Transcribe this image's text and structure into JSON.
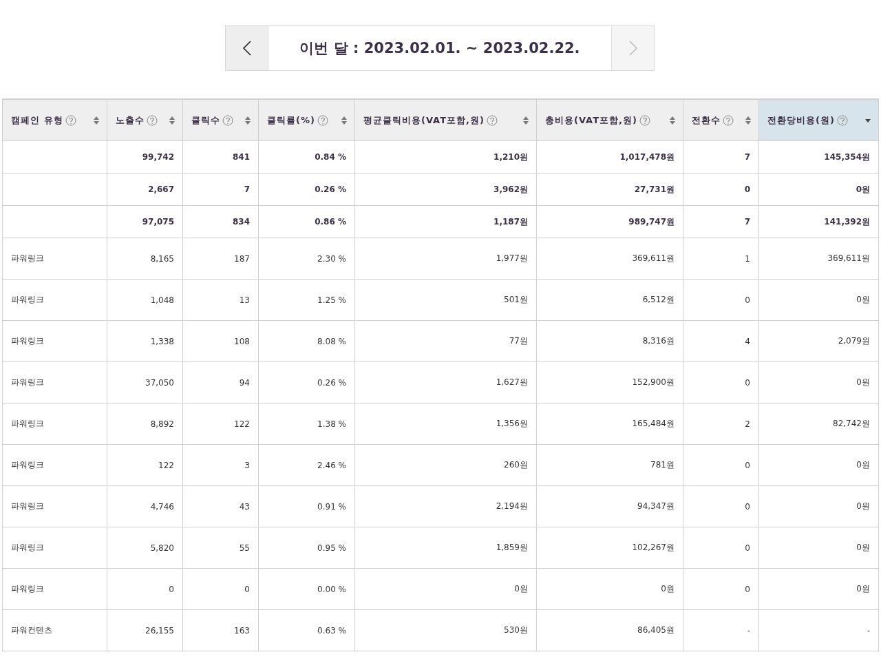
{
  "period": {
    "label": "이번 달 : 2023.02.01. ~ 2023.02.22.",
    "prev_disabled": false,
    "next_disabled": true
  },
  "table": {
    "columns": [
      {
        "label": "캠페인 유형",
        "sorted": false
      },
      {
        "label": "노출수",
        "sorted": false
      },
      {
        "label": "클릭수",
        "sorted": false
      },
      {
        "label": "클릭률(%)",
        "sorted": false
      },
      {
        "label": "평균클릭비용(VAT포함,원)",
        "sorted": false
      },
      {
        "label": "총비용(VAT포함,원)",
        "sorted": false
      },
      {
        "label": "전환수",
        "sorted": false
      },
      {
        "label": "전환당비용(원)",
        "sorted": true
      }
    ],
    "rows": [
      {
        "kind": "summary",
        "cells": [
          "",
          "99,742",
          "841",
          "0.84 %",
          "1,210원",
          "1,017,478원",
          "7",
          "145,354원"
        ]
      },
      {
        "kind": "summary",
        "cells": [
          "",
          "2,667",
          "7",
          "0.26 %",
          "3,962원",
          "27,731원",
          "0",
          "0원"
        ]
      },
      {
        "kind": "summary",
        "cells": [
          "",
          "97,075",
          "834",
          "0.86 %",
          "1,187원",
          "989,747원",
          "7",
          "141,392원"
        ]
      },
      {
        "kind": "data",
        "cells": [
          "파워링크",
          "8,165",
          "187",
          "2.30 %",
          "1,977원",
          "369,611원",
          "1",
          "369,611원"
        ]
      },
      {
        "kind": "data",
        "cells": [
          "파워링크",
          "1,048",
          "13",
          "1.25 %",
          "501원",
          "6,512원",
          "0",
          "0원"
        ]
      },
      {
        "kind": "data",
        "cells": [
          "파워링크",
          "1,338",
          "108",
          "8.08 %",
          "77원",
          "8,316원",
          "4",
          "2,079원"
        ]
      },
      {
        "kind": "data",
        "cells": [
          "파워링크",
          "37,050",
          "94",
          "0.26 %",
          "1,627원",
          "152,900원",
          "0",
          "0원"
        ]
      },
      {
        "kind": "data",
        "cells": [
          "파워링크",
          "8,892",
          "122",
          "1.38 %",
          "1,356원",
          "165,484원",
          "2",
          "82,742원"
        ]
      },
      {
        "kind": "data",
        "cells": [
          "파워링크",
          "122",
          "3",
          "2.46 %",
          "260원",
          "781원",
          "0",
          "0원"
        ]
      },
      {
        "kind": "data",
        "cells": [
          "파워링크",
          "4,746",
          "43",
          "0.91 %",
          "2,194원",
          "94,347원",
          "0",
          "0원"
        ]
      },
      {
        "kind": "data",
        "cells": [
          "파워링크",
          "5,820",
          "55",
          "0.95 %",
          "1,859원",
          "102,267원",
          "0",
          "0원"
        ]
      },
      {
        "kind": "data",
        "cells": [
          "파워링크",
          "0",
          "0",
          "0.00 %",
          "0원",
          "0원",
          "0",
          "0원"
        ]
      },
      {
        "kind": "data",
        "cells": [
          "파워컨텐츠",
          "26,155",
          "163",
          "0.63 %",
          "530원",
          "86,405원",
          "-",
          "-"
        ]
      }
    ]
  }
}
